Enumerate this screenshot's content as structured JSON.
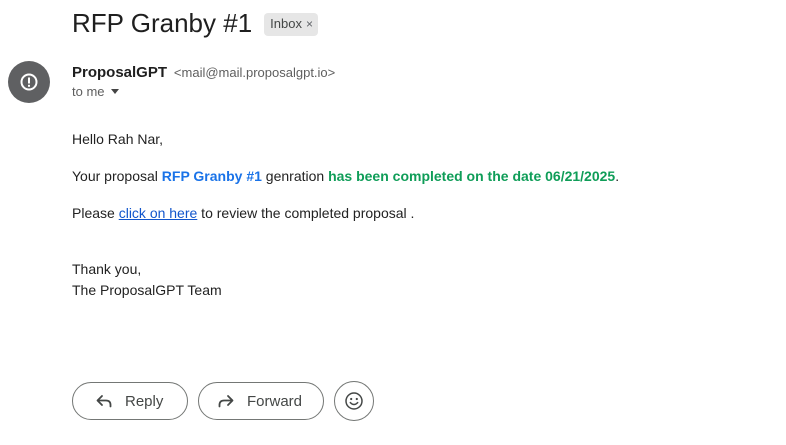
{
  "email": {
    "subject": "RFP Granby #1",
    "label_chip": "Inbox",
    "label_remove_glyph": "×",
    "sender": {
      "avatar_icon": "alert-circle-icon",
      "name": "ProposalGPT",
      "email": "<mail@mail.proposalgpt.io>"
    },
    "to_text": "to me",
    "body": {
      "greeting": "Hello Rah Nar,",
      "line2_prefix": "Your proposal ",
      "line2_proposal": "RFP Granby #1",
      "line2_mid": " genration ",
      "line2_status": "has been completed on the date 06/21/2025",
      "line2_suffix": ".",
      "line3_prefix": "Please ",
      "line3_link": "click on here",
      "line3_suffix": " to review the completed proposal .",
      "thanks": "Thank you,",
      "signature": "The ProposalGPT Team"
    }
  },
  "actions": {
    "reply_label": "Reply",
    "reply_icon": "reply-icon",
    "forward_label": "Forward",
    "forward_icon": "forward-icon",
    "emoji_icon": "smiley-icon"
  },
  "colors": {
    "proposal_name": "#1a73e8",
    "status_text": "#0f9d58",
    "link": "#1155cc",
    "avatar_bg": "#5f6062"
  }
}
